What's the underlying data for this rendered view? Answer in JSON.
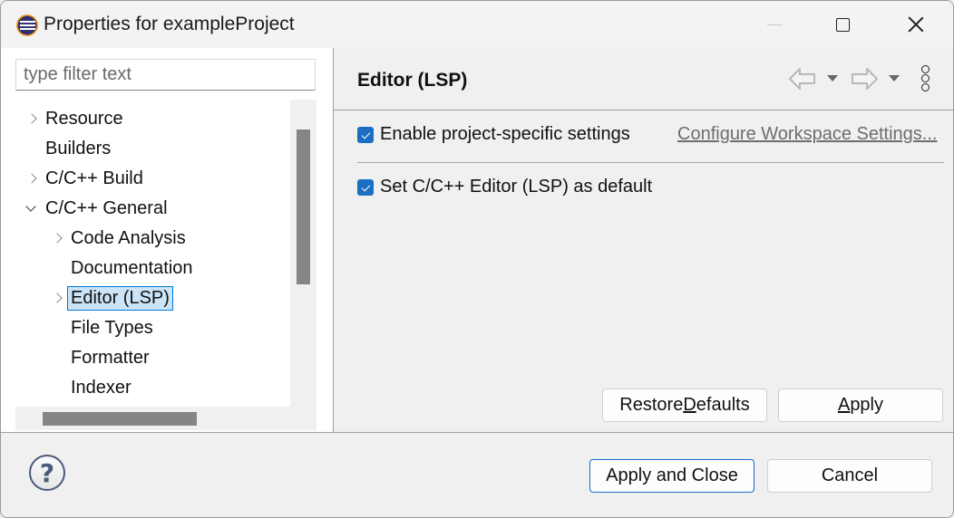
{
  "window": {
    "title": "Properties for exampleProject",
    "controls": {
      "minimize": "minimize-icon",
      "maximize": "maximize-icon",
      "close": "close-icon"
    }
  },
  "sidebar": {
    "filter_placeholder": "type filter text",
    "filter_value": "",
    "tree": [
      {
        "label": "Resource",
        "level": 0,
        "expander": "collapsed"
      },
      {
        "label": "Builders",
        "level": 0,
        "expander": "none"
      },
      {
        "label": "C/C++ Build",
        "level": 0,
        "expander": "collapsed"
      },
      {
        "label": "C/C++ General",
        "level": 0,
        "expander": "expanded"
      },
      {
        "label": "Code Analysis",
        "level": 1,
        "expander": "collapsed"
      },
      {
        "label": "Documentation",
        "level": 1,
        "expander": "none"
      },
      {
        "label": "Editor (LSP)",
        "level": 1,
        "expander": "collapsed",
        "selected": true
      },
      {
        "label": "File Types",
        "level": 1,
        "expander": "none"
      },
      {
        "label": "Formatter",
        "level": 1,
        "expander": "none"
      },
      {
        "label": "Indexer",
        "level": 1,
        "expander": "none"
      }
    ]
  },
  "page": {
    "title": "Editor (LSP)",
    "nav": {
      "back": "back-arrow-icon",
      "forward": "forward-arrow-icon",
      "menu": "more-options-icon"
    },
    "enable_project_specific": {
      "label": "Enable project-specific settings",
      "checked": true
    },
    "configure_link": "Configure Workspace Settings...",
    "set_default": {
      "label": "Set C/C++ Editor (LSP) as default",
      "checked": true
    },
    "restore_defaults": {
      "pre": "Restore ",
      "mnemonic": "D",
      "post": "efaults"
    },
    "apply": {
      "pre": "",
      "mnemonic": "A",
      "post": "pply"
    }
  },
  "footer": {
    "apply_and_close": "Apply and Close",
    "cancel": "Cancel",
    "help_glyph": "?"
  },
  "colors": {
    "accent": "#1a6fc2",
    "selection_bg": "#cce4f7",
    "selection_border": "#0078d7"
  }
}
